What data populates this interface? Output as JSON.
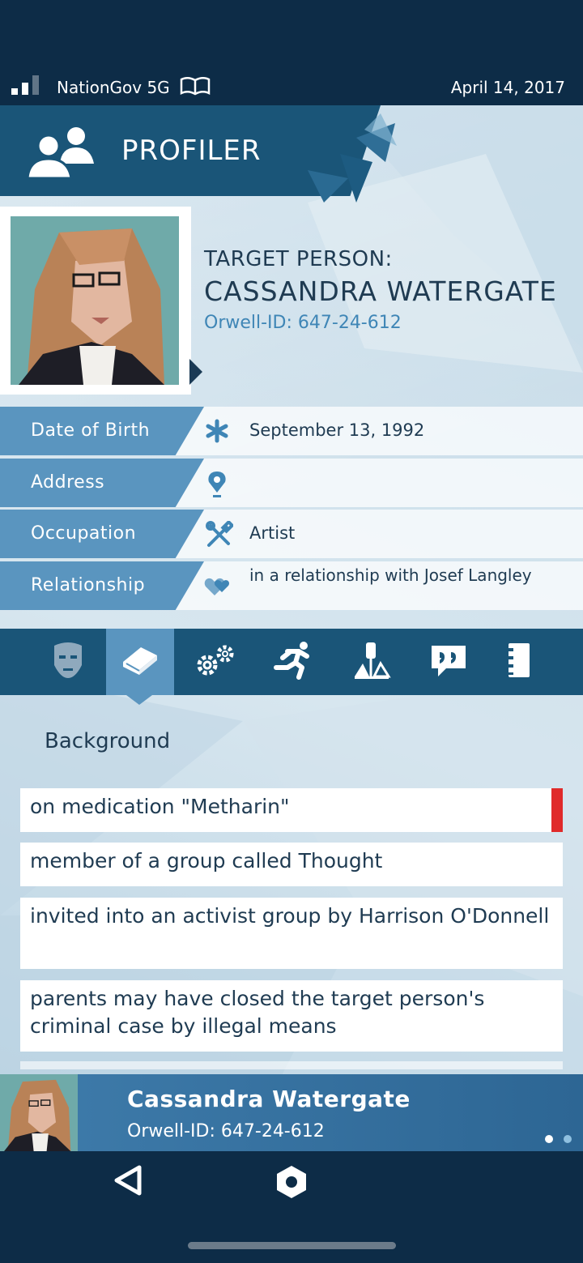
{
  "status_bar": {
    "carrier": "NationGov 5G",
    "date": "April 14, 2017"
  },
  "header": {
    "title": "PROFILER"
  },
  "target": {
    "label": "TARGET PERSON:",
    "name": "CASSANDRA WATERGATE",
    "orwell_id": "Orwell-ID: 647-24-612"
  },
  "info": [
    {
      "label": "Date of Birth",
      "icon": "asterisk-icon",
      "value": "September 13, 1992"
    },
    {
      "label": "Address",
      "icon": "location-pin-icon",
      "value": ""
    },
    {
      "label": "Occupation",
      "icon": "tools-icon",
      "value": "Artist"
    },
    {
      "label": "Relationship",
      "icon": "hearts-icon",
      "value": "in a relationship with Josef Langley"
    }
  ],
  "tabs": [
    {
      "name": "face-icon",
      "active": false
    },
    {
      "name": "book-icon",
      "active": true
    },
    {
      "name": "gears-icon",
      "active": false
    },
    {
      "name": "running-person-icon",
      "active": false
    },
    {
      "name": "justice-icon",
      "active": false
    },
    {
      "name": "quote-icon",
      "active": false
    },
    {
      "name": "notebook-icon",
      "active": false
    }
  ],
  "section": {
    "title": "Background"
  },
  "entries": [
    {
      "text": "on medication \"Metharin\"",
      "flagged": true
    },
    {
      "text": "member of a group called Thought",
      "flagged": false
    },
    {
      "text": "invited into an activist group by Harrison O'Donnell",
      "flagged": false
    },
    {
      "text": "parents may have closed the target person's criminal case by illegal means",
      "flagged": false
    }
  ],
  "bottom_card": {
    "name": "Cassandra Watergate",
    "orwell_id": "Orwell-ID: 647-24-612"
  },
  "colors": {
    "header_band": "#1a5578",
    "label_blue": "#5a95bf",
    "flag_red": "#e02a2a",
    "id_blue": "#3f86b6"
  }
}
